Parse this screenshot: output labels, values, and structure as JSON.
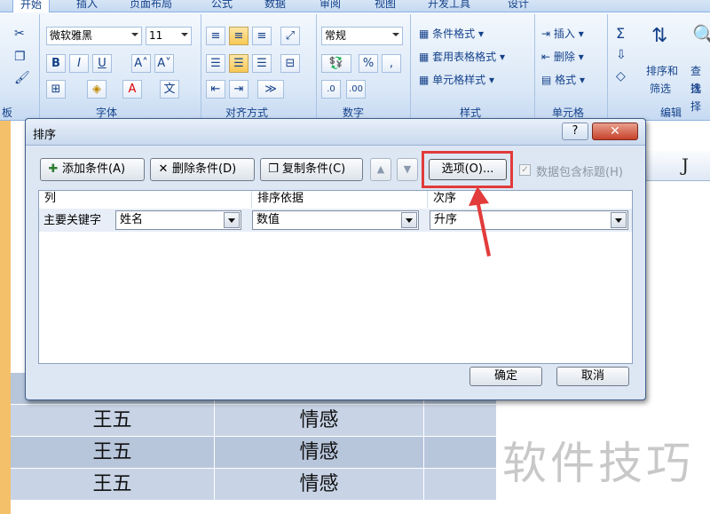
{
  "ribbon": {
    "tabs": [
      "开始",
      "插入",
      "页面布局",
      "公式",
      "数据",
      "审阅",
      "视图",
      "开发工具",
      "设计"
    ],
    "font_name": "微软雅黑",
    "font_size": "11",
    "number_format": "常规",
    "styles": {
      "conditional": "条件格式",
      "table_format": "套用表格格式",
      "cell_styles": "单元格样式"
    },
    "cells": {
      "insert": "插入",
      "delete": "删除",
      "format": "格式"
    },
    "editing": {
      "sort_filter": "排序和",
      "sort_filter_2": "筛选",
      "find": "查找",
      "find_2": "选择"
    },
    "groups": [
      "板",
      "字体",
      "对齐方式",
      "数字",
      "样式",
      "单元格",
      "编辑"
    ]
  },
  "sheet": {
    "column_header": "J",
    "rows": [
      {
        "name": "王五",
        "category": "情感"
      },
      {
        "name": "王五",
        "category": "情感"
      },
      {
        "name": "王五",
        "category": "情感"
      }
    ]
  },
  "watermark": "软件技巧",
  "dialog": {
    "title": "排序",
    "help": "?",
    "close": "✕",
    "add_condition": "添加条件(A)",
    "delete_condition": "删除条件(D)",
    "copy_condition": "复制条件(C)",
    "options": "选项(O)...",
    "has_header": "数据包含标题(H)",
    "headers": {
      "column": "列",
      "sort_on": "排序依据",
      "order": "次序"
    },
    "row": {
      "label": "主要关键字",
      "column_value": "姓名",
      "sort_on_value": "数值",
      "order_value": "升序"
    },
    "ok": "确定",
    "cancel": "取消"
  }
}
